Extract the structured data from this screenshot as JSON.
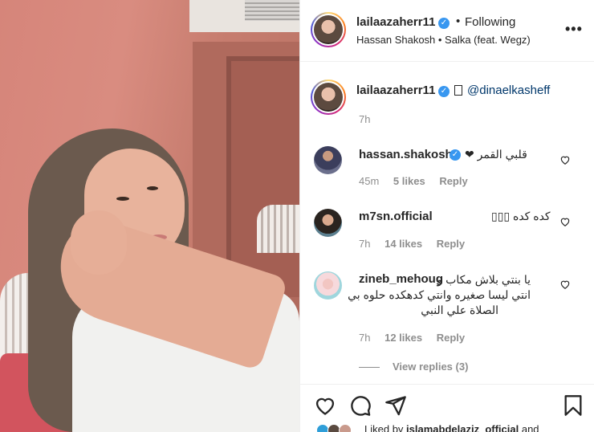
{
  "post": {
    "author": "lailaazaherr11",
    "follow_separator": "•",
    "follow_status": "Following",
    "music": "Hassan Shakosh • Salka (feat. Wegz)",
    "more_label": "•••",
    "verified_glyph": "✓"
  },
  "caption": {
    "author": "lailaazaherr11",
    "mention": "@dinaelkasheff",
    "time": "7h"
  },
  "comments": [
    {
      "username": "hassan.shakosh",
      "verified": true,
      "text": "قلبي القمر ❤",
      "time": "45m",
      "likes": "5 likes",
      "reply": "Reply"
    },
    {
      "username": "m7sn.official",
      "verified": false,
      "text": "كده كده ▯▯▯",
      "time": "7h",
      "likes": "14 likes",
      "reply": "Reply"
    },
    {
      "username": "zineb_mehoug",
      "verified": false,
      "text_lines": [
        "يا بنتي بلاش مكاب و",
        "انتي ليسا صغيره وانتي كدهكده حلوه بي",
        "الصلاة علي النبي"
      ],
      "time": "7h",
      "likes": "12 likes",
      "reply": "Reply"
    }
  ],
  "view_replies": "View replies (3)",
  "liked_by": {
    "prefix": "Liked by",
    "user": "islamabdelaziz_official",
    "suffix": "and"
  },
  "icons": {
    "like": "heart-icon",
    "comment": "comment-icon",
    "share": "share-icon",
    "save": "bookmark-icon"
  }
}
